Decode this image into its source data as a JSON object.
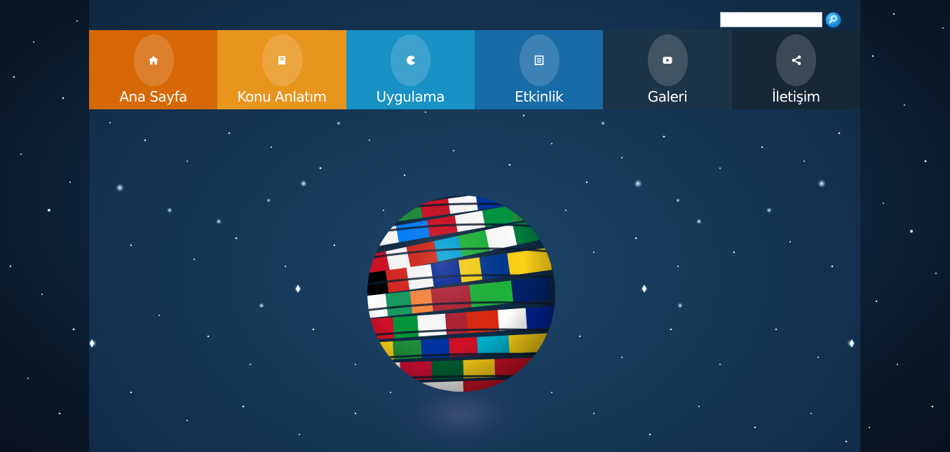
{
  "search": {
    "value": "",
    "placeholder": "",
    "button_icon": "magnifier-icon"
  },
  "nav": {
    "items": [
      {
        "label": "Ana Sayfa",
        "icon": "home-icon",
        "color": "#d66806"
      },
      {
        "label": "Konu Anlatım",
        "icon": "book-icon",
        "color": "#e8951e"
      },
      {
        "label": "Uygulama",
        "icon": "pacman-icon",
        "color": "#1891c4"
      },
      {
        "label": "Etkinlik",
        "icon": "document-icon",
        "color": "#176ba6"
      },
      {
        "label": "Galeri",
        "icon": "play-icon",
        "color": "#1c3447"
      },
      {
        "label": "İletişim",
        "icon": "share-icon",
        "color": "#162737"
      }
    ]
  },
  "hero": {
    "image": "flag-globe"
  }
}
